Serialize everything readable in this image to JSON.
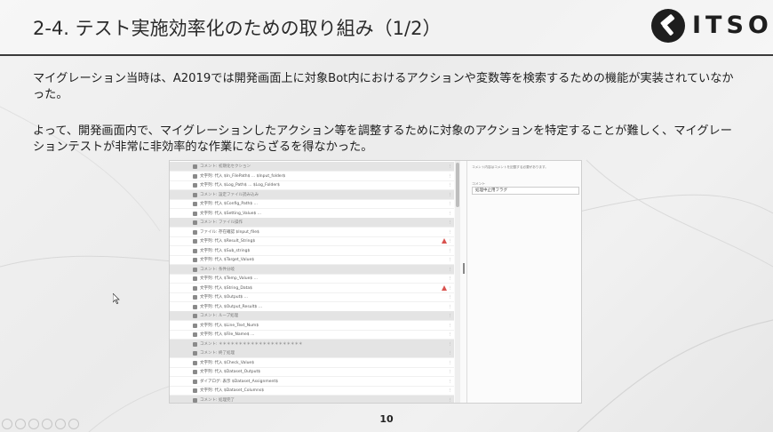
{
  "slide": {
    "title": "2-4. テスト実施効率化のための取り組み（1/2）",
    "logo_text": "ITSO",
    "paragraph1": "マイグレーション当時は、A2019では開発画面上に対象Bot内におけるアクションや変数等を検索するための機能が実装されていなかった。",
    "paragraph2": "よって、開発画面内で、マイグレーションしたアクション等を調整するために対象のアクションを特定することが難しく、マイグレーションテストが非常に非効率的な作業にならざるを得なかった。",
    "page_number": "10"
  },
  "screenshot": {
    "rows": [
      {
        "type": "comment",
        "text": "コメント: 初期化セクション"
      },
      {
        "type": "action",
        "text": "文字列: 代入  $In_FilePath$ ...  $Input_folder$"
      },
      {
        "type": "action",
        "text": "文字列: 代入  $Log_Path$ ...  $Log_Folder$"
      },
      {
        "type": "comment",
        "text": "コメント: 設定ファイル読み込み"
      },
      {
        "type": "action",
        "text": "文字列: 代入  $Config_Path$ ..."
      },
      {
        "type": "action",
        "text": "文字列: 代入  $Setting_Value$ ..."
      },
      {
        "type": "comment",
        "text": "コメント: ファイル操作"
      },
      {
        "type": "action",
        "text": "ファイル: 存在確認  $Input_file$"
      },
      {
        "type": "action",
        "text": "文字列: 代入  $Result_String$",
        "warn": true
      },
      {
        "type": "action",
        "text": "文字列: 代入  $Sub_string$"
      },
      {
        "type": "action",
        "text": "文字列: 代入  $Target_Value$"
      },
      {
        "type": "comment",
        "text": "コメント: 条件分岐"
      },
      {
        "type": "action",
        "text": "文字列: 代入  $Temp_Value$ ..."
      },
      {
        "type": "action",
        "text": "文字列: 代入  $String_Data$",
        "warn": true
      },
      {
        "type": "action",
        "text": "文字列: 代入  $Output$ ..."
      },
      {
        "type": "action",
        "text": "文字列: 代入  $Output_Result$ ..."
      },
      {
        "type": "comment",
        "text": "コメント: ループ処理"
      },
      {
        "type": "action",
        "text": "文字列: 代入  $Line_Text_Num$"
      },
      {
        "type": "action",
        "text": "文字列: 代入  $File_Name$ ..."
      },
      {
        "type": "comment",
        "text": "コメント: ＊＊＊＊＊＊＊＊＊＊＊＊＊＊＊＊＊＊＊＊＊"
      },
      {
        "type": "comment",
        "text": "コメント: 終了処理"
      },
      {
        "type": "action",
        "text": "文字列: 代入  $Check_Value$"
      },
      {
        "type": "action",
        "text": "文字列: 代入  $Dataset_Output$"
      },
      {
        "type": "action",
        "text": "ダイアログ: 表示  $Dataset_Assignment$"
      },
      {
        "type": "action",
        "text": "文字列: 代入  $Dataset_Columns$"
      },
      {
        "type": "comment",
        "text": "コメント: 処理完了"
      }
    ],
    "panel_description": "コメント内容はコメントを記載する必要があります。",
    "panel_label": "コメント",
    "panel_value": "処理中止用フラグ"
  }
}
